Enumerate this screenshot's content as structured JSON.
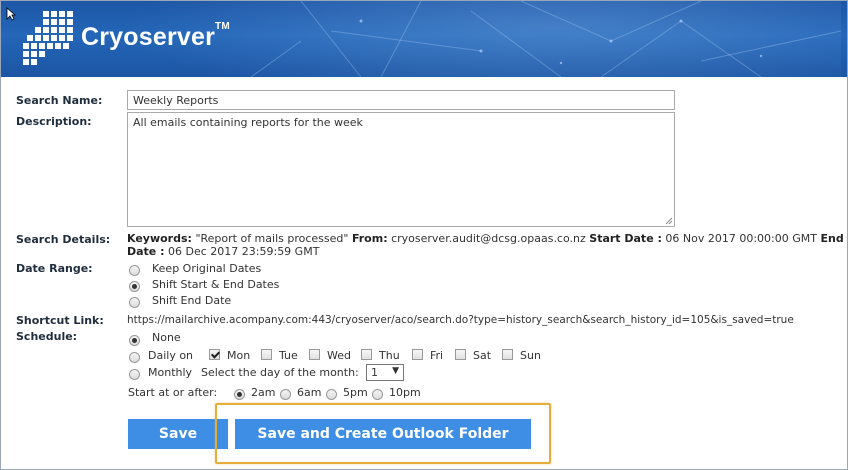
{
  "brand": {
    "name": "Cryoserver",
    "trademark": "TM"
  },
  "labels": {
    "search_name": "Search Name:",
    "description": "Description:",
    "search_details": "Search Details:",
    "date_range": "Date Range:",
    "shortcut_link": "Shortcut Link:",
    "schedule": "Schedule:"
  },
  "search_name_value": "Weekly Reports",
  "description_value": "All emails containing reports for the week",
  "details": {
    "keywords_label": "Keywords:",
    "keywords_value": "\"Report of mails processed\"",
    "from_label": "From:",
    "from_value": "cryoserver.audit@dcsg.opaas.co.nz",
    "start_label": "Start Date :",
    "start_value": "06 Nov 2017 00:00:00 GMT",
    "end_label_1": "End",
    "end_label_2": "Date :",
    "end_value": "06 Dec 2017 23:59:59 GMT"
  },
  "date_range_options": [
    {
      "label": "Keep Original Dates",
      "selected": false
    },
    {
      "label": "Shift Start & End Dates",
      "selected": true
    },
    {
      "label": "Shift End Date",
      "selected": false
    }
  ],
  "shortcut_url": "https://mailarchive.acompany.com:443/cryoserver/aco/search.do?type=history_search&search_history_id=105&is_saved=true",
  "schedule": {
    "none_label": "None",
    "none_selected": true,
    "daily_label": "Daily on",
    "daily_selected": false,
    "days": [
      {
        "label": "Mon",
        "checked": true
      },
      {
        "label": "Tue",
        "checked": false
      },
      {
        "label": "Wed",
        "checked": false
      },
      {
        "label": "Thu",
        "checked": false
      },
      {
        "label": "Fri",
        "checked": false
      },
      {
        "label": "Sat",
        "checked": false
      },
      {
        "label": "Sun",
        "checked": false
      }
    ],
    "monthly_label": "Monthly",
    "monthly_selected": false,
    "monthly_prompt": "Select the day of the month:",
    "monthly_day": "1",
    "start_prompt": "Start at or after:",
    "times": [
      {
        "label": "2am",
        "selected": true
      },
      {
        "label": "6am",
        "selected": false
      },
      {
        "label": "5pm",
        "selected": false
      },
      {
        "label": "10pm",
        "selected": false
      }
    ]
  },
  "buttons": {
    "save": "Save",
    "save_create": "Save and Create Outlook Folder"
  },
  "colors": {
    "banner": "#2466b8",
    "button": "#3d8ee4",
    "highlight": "#e5ae3a"
  },
  "icons": {
    "cursor": "mouse-pointer-icon",
    "logo": "cryoserver-logo-grid-icon",
    "resize": "resize-grip-icon",
    "dropdown": "dropdown-arrow-icon"
  }
}
